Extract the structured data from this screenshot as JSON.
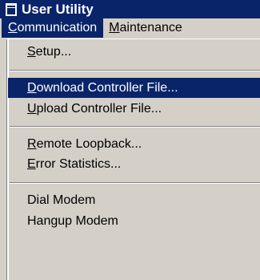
{
  "window": {
    "title": "User Utility"
  },
  "menubar": {
    "items": [
      {
        "first": "C",
        "rest": "ommunication"
      },
      {
        "first": "M",
        "rest": "aintenance"
      }
    ]
  },
  "menu": {
    "setup": {
      "first": "S",
      "rest": "etup..."
    },
    "download": {
      "first": "D",
      "rest": "ownload Controller File..."
    },
    "upload": {
      "first": "U",
      "rest": "pload Controller File..."
    },
    "loopback": {
      "first": "R",
      "rest": "emote Loopback..."
    },
    "errors": {
      "first": "E",
      "rest": "rror Statistics..."
    },
    "dial": "Dial Modem",
    "hangup": "Hangup Modem"
  },
  "colors": {
    "highlight": "#0a246a",
    "face": "#d4d0c8"
  }
}
